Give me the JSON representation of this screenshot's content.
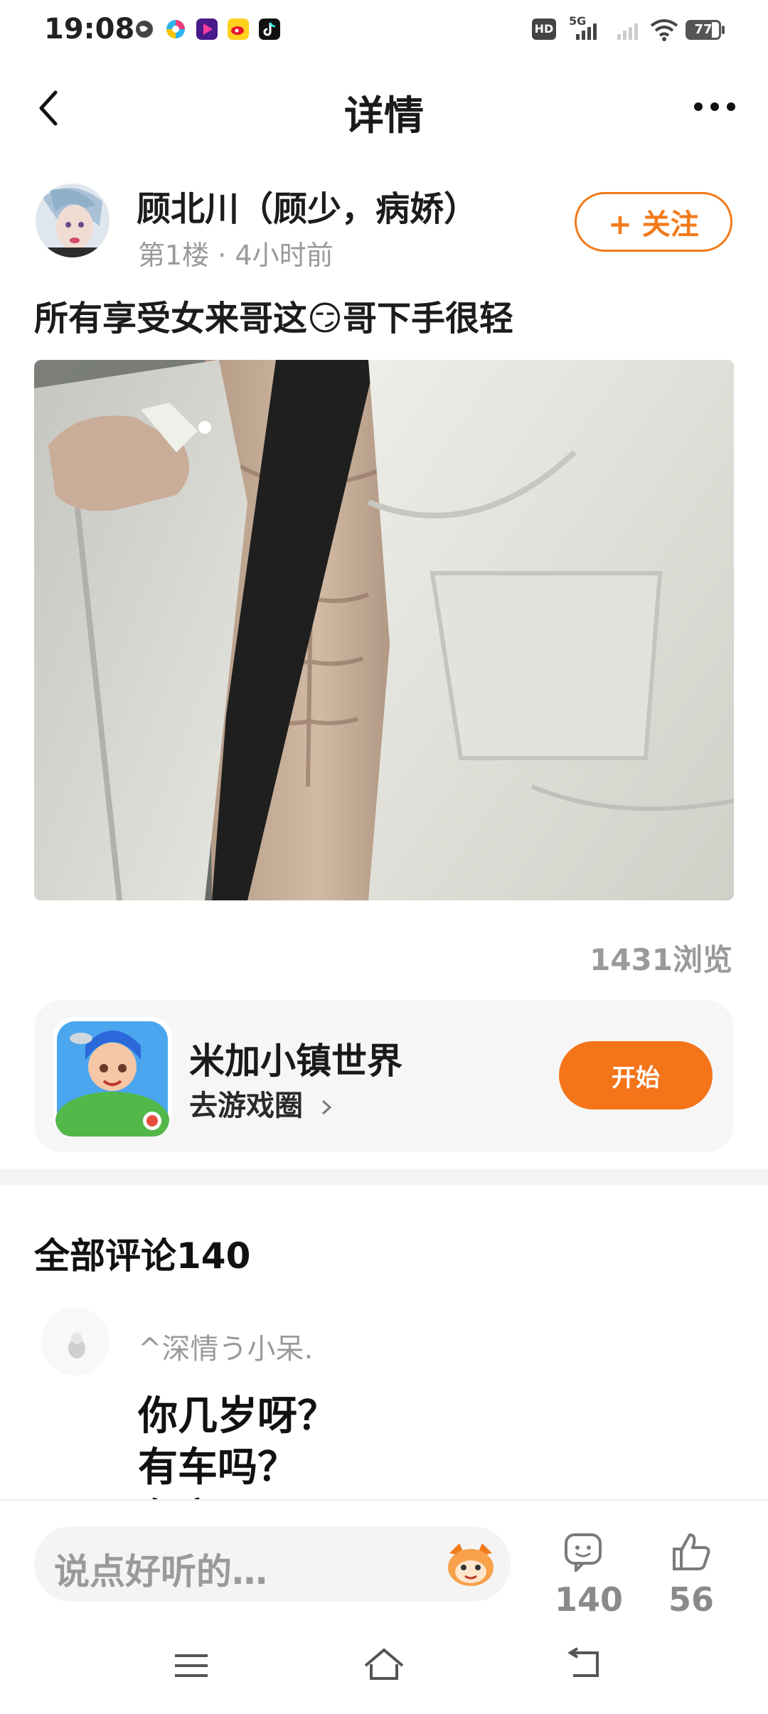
{
  "status_bar": {
    "time": "19:08",
    "hd_label": "HD",
    "network": "5G",
    "battery": "77",
    "app_icons": [
      "globe-icon",
      "colorful-app-icon",
      "video-app-icon",
      "weibo-icon",
      "tiktok-icon"
    ]
  },
  "nav": {
    "title": "详情"
  },
  "post": {
    "author": "顾北川（顾少，病娇）",
    "meta": "第1楼 · 4小时前",
    "follow_label": "+ 关注",
    "text": "所有享受女来哥这😏哥下手很轻",
    "views": "1431浏览"
  },
  "game_card": {
    "name": "米加小镇世界",
    "link": "去游戏圈",
    "button": "开始"
  },
  "comments": {
    "title": "全部评论140",
    "first": {
      "user": "^深情う小呆.",
      "lines": [
        "你几岁呀？",
        "有车吗？",
        "有房吗？"
      ]
    }
  },
  "bottom_bar": {
    "placeholder": "说点好听的…",
    "comment_count": "140",
    "like_count": "56"
  },
  "colors": {
    "accent": "#f4741a",
    "muted": "#9a9a9a"
  }
}
